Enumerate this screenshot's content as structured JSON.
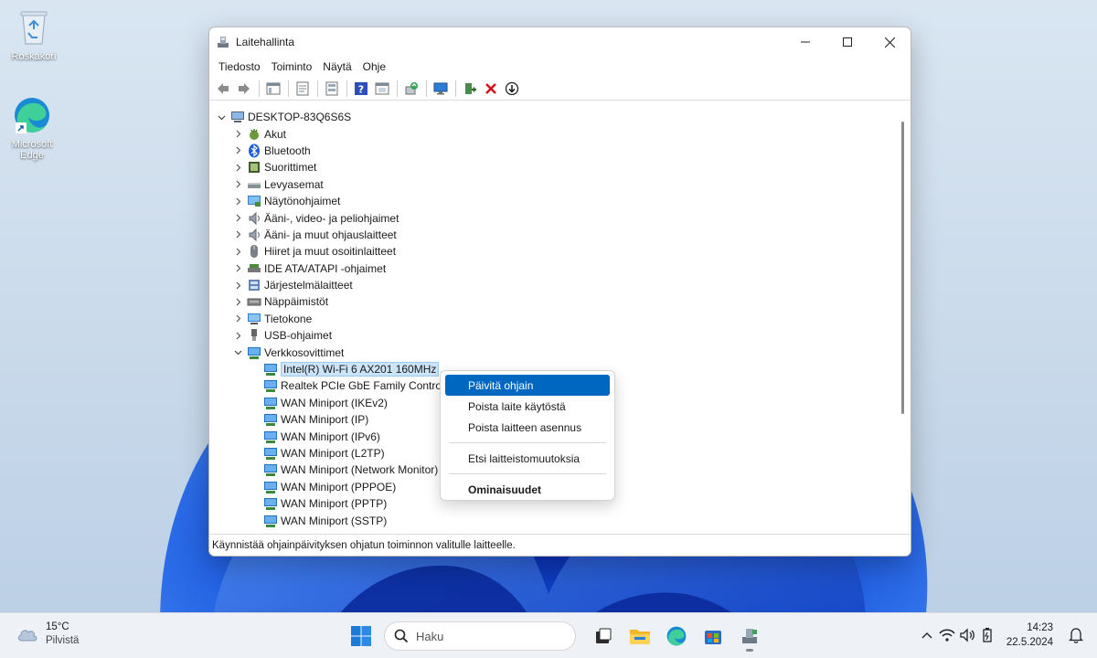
{
  "desktop": {
    "icons": [
      {
        "label": "Roskakori"
      },
      {
        "label": "Microsoft Edge"
      }
    ]
  },
  "window": {
    "title": "Laitehallinta",
    "menu": [
      "Tiedosto",
      "Toiminto",
      "Näytä",
      "Ohje"
    ],
    "tree": {
      "root": "DESKTOP-83Q6S6S",
      "categories": [
        {
          "label": "Akut",
          "icon": "battery-icon"
        },
        {
          "label": "Bluetooth",
          "icon": "bluetooth-icon"
        },
        {
          "label": "Suorittimet",
          "icon": "processor-icon"
        },
        {
          "label": "Levyasemat",
          "icon": "disk-drive-icon"
        },
        {
          "label": "Näytönohjaimet",
          "icon": "display-adapter-icon"
        },
        {
          "label": "Ääni-, video- ja peliohjaimet",
          "icon": "speaker-icon"
        },
        {
          "label": "Ääni- ja muut ohjauslaitteet",
          "icon": "speaker-icon"
        },
        {
          "label": "Hiiret ja muut osoitinlaitteet",
          "icon": "mouse-icon"
        },
        {
          "label": "IDE ATA/ATAPI -ohjaimet",
          "icon": "ide-controller-icon"
        },
        {
          "label": "Järjestelmälaitteet",
          "icon": "system-devices-icon"
        },
        {
          "label": "Näppäimistöt",
          "icon": "keyboard-icon"
        },
        {
          "label": "Tietokone",
          "icon": "computer-icon"
        },
        {
          "label": "USB-ohjaimet",
          "icon": "usb-icon"
        },
        {
          "label": "Verkkosovittimet",
          "icon": "network-adapter-icon",
          "expanded": true
        }
      ],
      "network_adapters": [
        "Intel(R) Wi-Fi 6 AX201 160MHz",
        "Realtek PCIe GbE Family Controller",
        "WAN Miniport (IKEv2)",
        "WAN Miniport (IP)",
        "WAN Miniport (IPv6)",
        "WAN Miniport (L2TP)",
        "WAN Miniport (Network Monitor)",
        "WAN Miniport (PPPOE)",
        "WAN Miniport (PPTP)",
        "WAN Miniport (SSTP)"
      ]
    },
    "status_text": "Käynnistää ohjainpäivityksen ohjatun toiminnon valitulle laitteelle."
  },
  "context_menu": {
    "items": [
      {
        "label": "Päivitä ohjain",
        "active": true
      },
      {
        "label": "Poista laite käytöstä"
      },
      {
        "label": "Poista laitteen asennus"
      },
      {
        "label": "Etsi laitteistomuutoksia"
      },
      {
        "label": "Ominaisuudet",
        "bold": true
      }
    ]
  },
  "taskbar": {
    "weather": {
      "temp": "15°C",
      "condition": "Pilvistä"
    },
    "search_placeholder": "Haku",
    "clock": {
      "time": "14:23",
      "date": "22.5.2024"
    }
  },
  "colors": {
    "accent": "#0067c0",
    "selection": "#cce4f7",
    "wallpaper_blue": "#1552d9"
  }
}
